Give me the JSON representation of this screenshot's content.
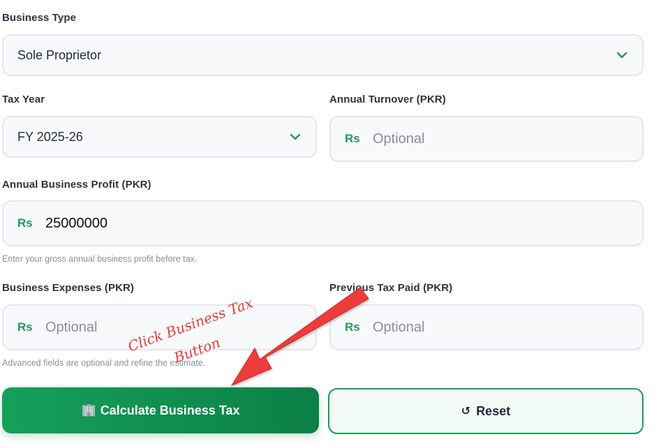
{
  "form": {
    "business_type": {
      "label": "Business Type",
      "value": "Sole Proprietor"
    },
    "tax_year": {
      "label": "Tax Year",
      "value": "FY 2025-26"
    },
    "annual_turnover": {
      "label": "Annual Turnover (PKR)",
      "prefix": "Rs",
      "value": "",
      "placeholder": "Optional"
    },
    "annual_profit": {
      "label": "Annual Business Profit (PKR)",
      "prefix": "Rs",
      "value": "25000000",
      "placeholder": "",
      "hint": "Enter your gross annual business profit before tax."
    },
    "business_expenses": {
      "label": "Business Expenses (PKR)",
      "prefix": "Rs",
      "value": "",
      "placeholder": "Optional"
    },
    "previous_tax_paid": {
      "label": "Previous Tax Paid (PKR)",
      "prefix": "Rs",
      "value": "",
      "placeholder": "Optional"
    },
    "advanced_hint": "Advanced fields are optional and refine the estimate."
  },
  "buttons": {
    "calculate": {
      "icon": "🏢",
      "label": "Calculate Business Tax"
    },
    "reset": {
      "icon": "↺",
      "label": "Reset"
    }
  },
  "annotation": {
    "line1": "Click Business Tax",
    "line2": "Button",
    "color": "#e93a3a"
  },
  "colors": {
    "accent": "#1f9a5a",
    "primary_button": "#0b8046"
  }
}
